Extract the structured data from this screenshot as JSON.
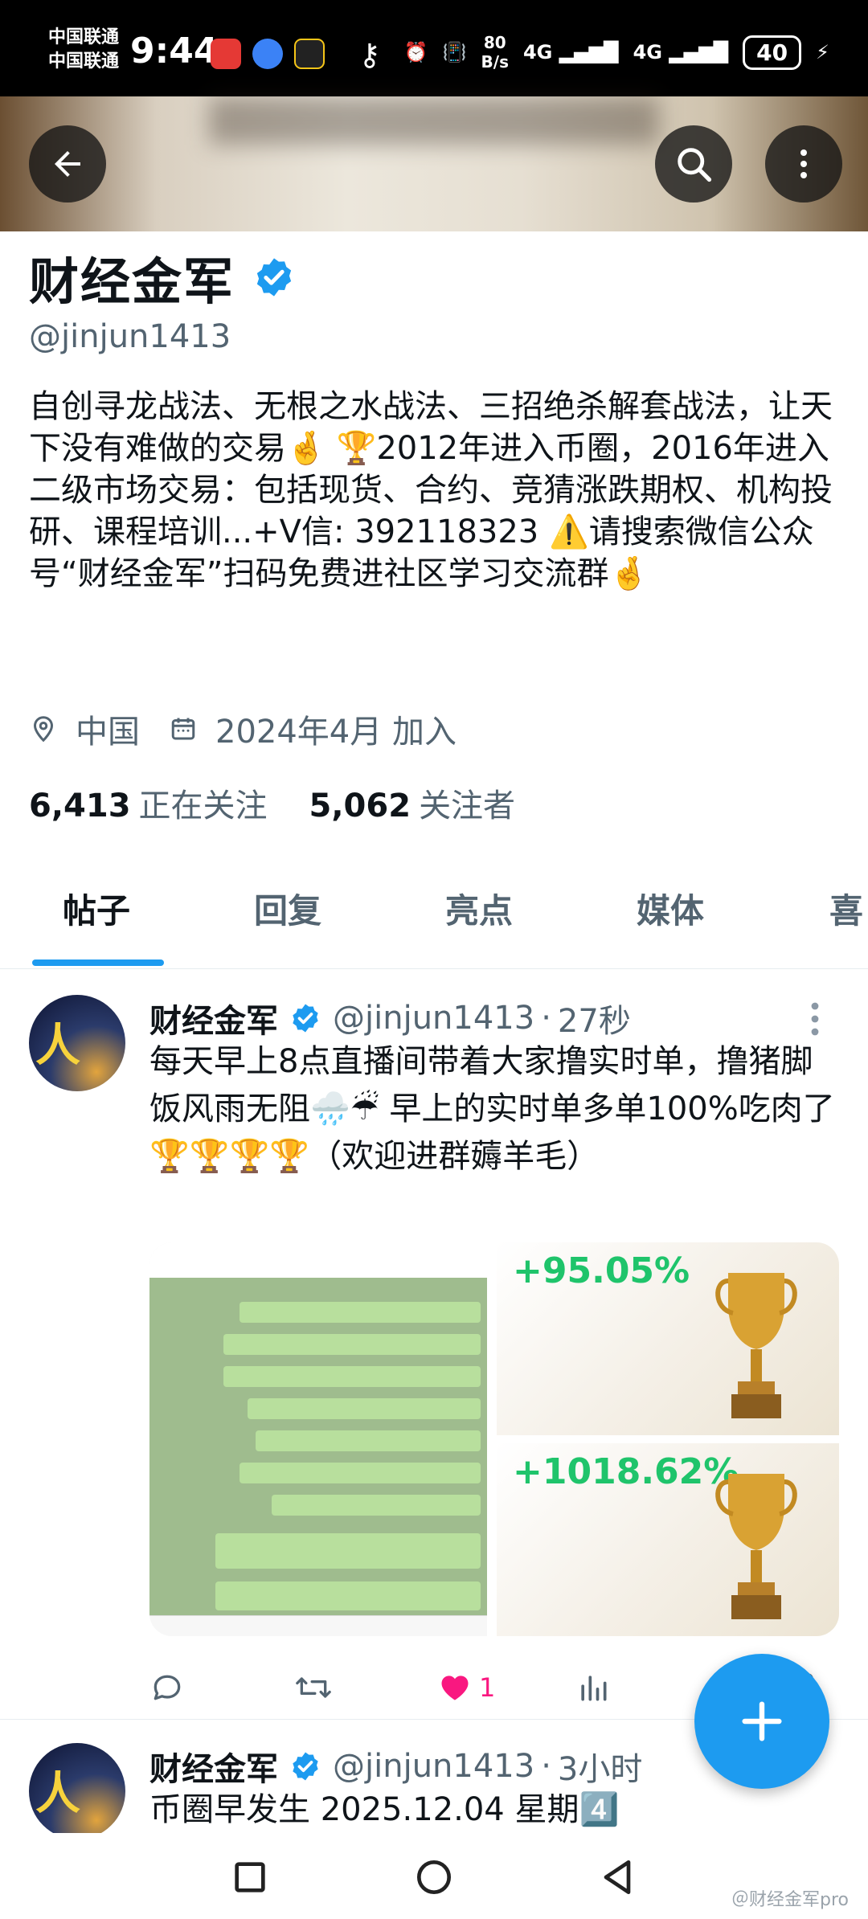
{
  "status_bar": {
    "carrier_1": "中国联通",
    "carrier_2": "中国联通",
    "time": "9:44",
    "net_speed_value": "80",
    "net_speed_unit": "B/s",
    "signal_1": "4G",
    "signal_2": "4G",
    "battery": "40",
    "icons": [
      "huawei-app-icon",
      "chat-app-icon",
      "u-app-icon",
      "key-icon",
      "alarm-icon",
      "vibrate-icon",
      "signal-icon",
      "battery-icon",
      "charging-icon"
    ]
  },
  "header": {
    "icons": [
      "back-arrow-icon",
      "search-icon",
      "more-vertical-icon"
    ]
  },
  "profile": {
    "name": "财经金军",
    "handle": "@jinjun1413",
    "bio": "自创寻龙战法、无根之水战法、三招绝杀解套战法，让天下没有难做的交易🤞 🏆2012年进入币圈，2016年进入二级市场交易：包括现货、合约、竞猜涨跌期权、机构投研、课程培训...+V信: 392118323 ⚠️请搜索微信公众号“财经金军”扫码免费进社区学习交流群🤞",
    "location": "中国",
    "joined": "2024年4月 加入",
    "following_count": "6,413",
    "following_label": "正在关注",
    "followers_count": "5,062",
    "followers_label": "关注者",
    "accent": "#1d9bf0"
  },
  "tabs": [
    {
      "label": "帖子",
      "active": true
    },
    {
      "label": "回复",
      "active": false
    },
    {
      "label": "亮点",
      "active": false
    },
    {
      "label": "媒体",
      "active": false
    },
    {
      "label": "喜",
      "active": false
    }
  ],
  "posts": [
    {
      "author": "财经金军",
      "handle": "@jinjun1413",
      "sep": "·",
      "time": "27秒",
      "text": "每天早上8点直播间带着大家撸实时单，撸猪脚饭风雨无阻🌧️☔ 早上的实时单多单100%吃肉了🏆🏆🏆🏆（欢迎进群薅羊毛）",
      "media": {
        "tile_1_value": "+95.05%",
        "tile_2_value": "+1018.62%"
      },
      "likes": "1",
      "like_color": "#f91880"
    },
    {
      "author": "财经金军",
      "handle": "@jinjun1413",
      "sep": "·",
      "time": "3小时",
      "text": "币圈早发生 2025.12.04 星期4️⃣"
    }
  ],
  "watermark": "＠财经金军pro"
}
